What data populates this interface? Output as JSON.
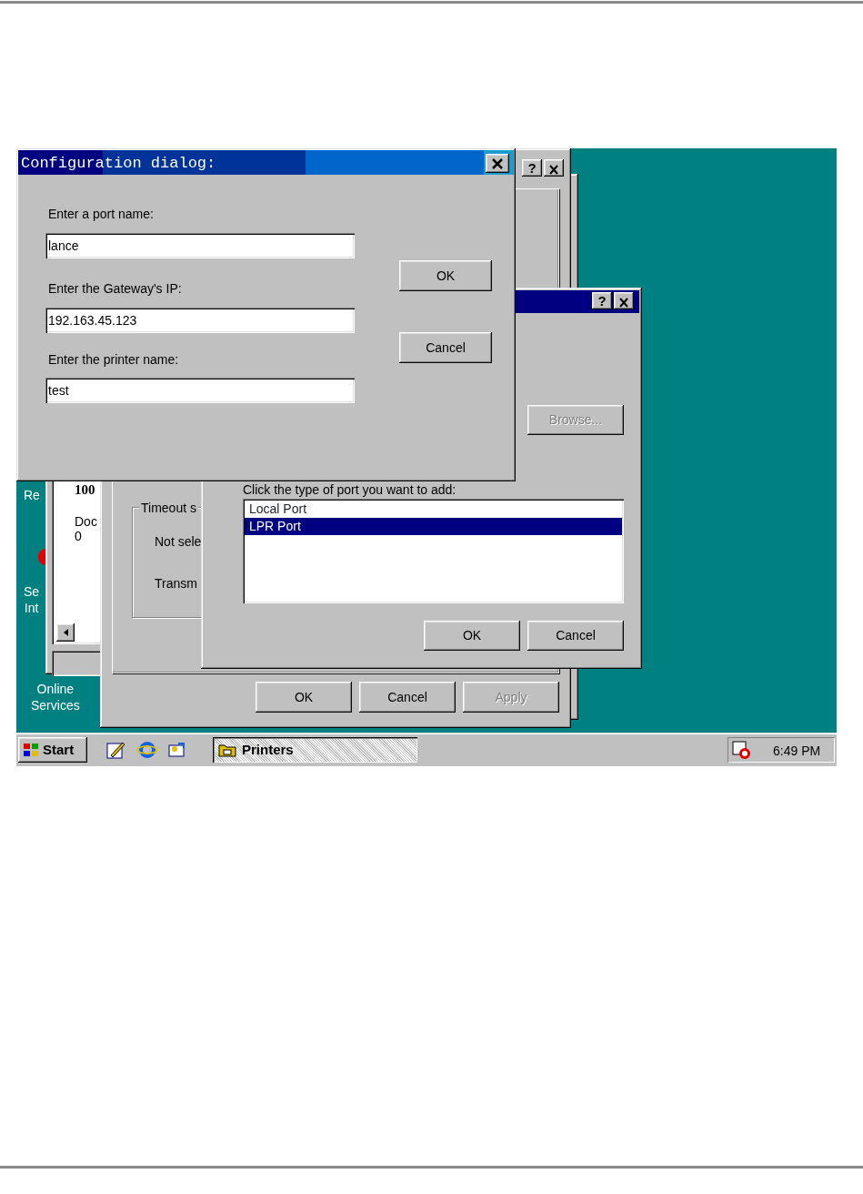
{
  "desktop_icons": [
    {
      "lines": [
        "Re"
      ]
    },
    {
      "lines": [
        "Se",
        "Int"
      ]
    },
    {
      "lines": [
        "Online",
        "Services"
      ]
    }
  ],
  "printers_window": {
    "lines": [
      {
        "text": "100",
        "bold": true
      },
      {
        "text": "Doc",
        "bold": false
      },
      {
        "text": "0",
        "bold": false
      }
    ]
  },
  "properties_dialog": {
    "help_button": "?",
    "group_label": "Timeout s",
    "fields": [
      {
        "label": "Not sele"
      },
      {
        "label": "Transm"
      }
    ],
    "buttons": [
      {
        "label": "OK",
        "disabled": false
      },
      {
        "label": "Cancel",
        "disabled": false
      },
      {
        "label": "Apply",
        "disabled": true
      }
    ]
  },
  "add_port_dialog": {
    "help_button": "?",
    "browse_button": {
      "label": "Browse...",
      "disabled": true
    },
    "prompt": "Click the type of port you want to add:",
    "ports": [
      {
        "label": "Local Port",
        "selected": false
      },
      {
        "label": "LPR Port",
        "selected": true
      }
    ],
    "buttons": [
      {
        "label": "OK",
        "disabled": false
      },
      {
        "label": "Cancel",
        "disabled": false
      }
    ]
  },
  "config_dialog": {
    "title": "Configuration dialog:",
    "fields": [
      {
        "label": "Enter a port name:",
        "value": "lance"
      },
      {
        "label": "Enter the Gateway's IP:",
        "value": "192.163.45.123"
      },
      {
        "label": "Enter the printer name:",
        "value": "test"
      }
    ],
    "buttons": [
      {
        "label": "OK",
        "disabled": false
      },
      {
        "label": "Cancel",
        "disabled": false
      }
    ]
  },
  "taskbar": {
    "start": "Start",
    "tasks": [
      {
        "label": "Printers",
        "selected": true
      }
    ],
    "clock": "6:49 PM"
  }
}
